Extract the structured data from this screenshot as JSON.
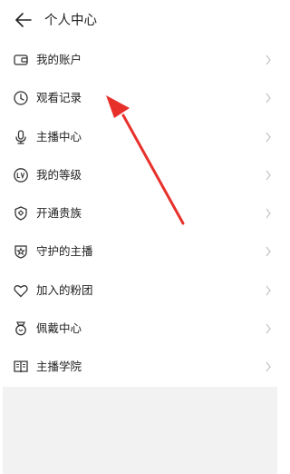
{
  "header": {
    "title": "个人中心"
  },
  "menu": {
    "items": [
      {
        "label": "我的账户",
        "icon": "wallet-icon"
      },
      {
        "label": "观看记录",
        "icon": "clock-icon"
      },
      {
        "label": "主播中心",
        "icon": "microphone-icon"
      },
      {
        "label": "我的等级",
        "icon": "level-badge-icon"
      },
      {
        "label": "开通贵族",
        "icon": "noble-shield-icon"
      },
      {
        "label": "守护的主播",
        "icon": "guard-shield-star-icon"
      },
      {
        "label": "加入的粉团",
        "icon": "heart-icon"
      },
      {
        "label": "佩戴中心",
        "icon": "medal-icon"
      },
      {
        "label": "主播学院",
        "icon": "book-icon"
      }
    ]
  },
  "colors": {
    "annotation_arrow": "#e8302b",
    "footer_bg": "#f2f2f2",
    "chevron": "#c2c2c2"
  }
}
